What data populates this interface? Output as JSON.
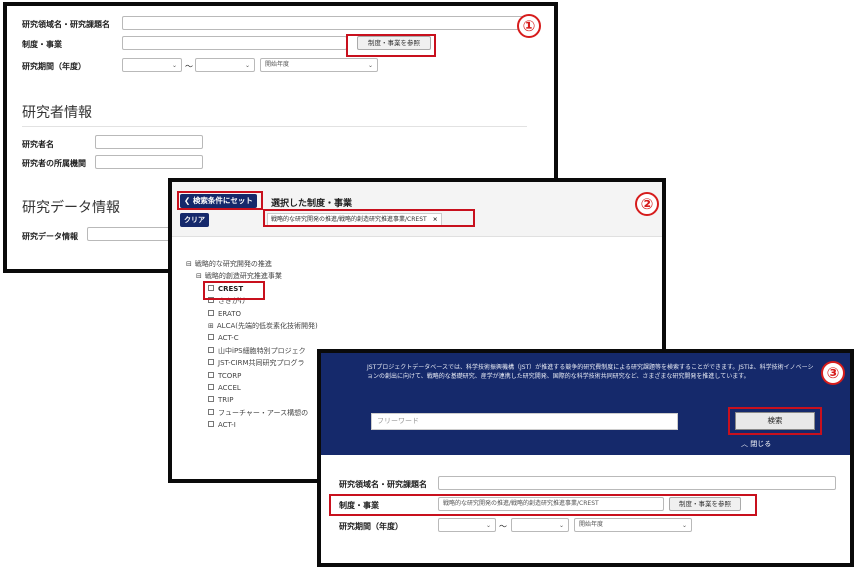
{
  "panel1": {
    "label_title": "研究領域名・研究課題名",
    "label_program": "制度・事業",
    "label_period": "研究期間（年度）",
    "period_tilde": "〜",
    "select_start": "",
    "select_end": "",
    "select_type": "開始年度",
    "ref_button": "制度・事業を参照",
    "section_researcher": "研究者情報",
    "label_researcher": "研究者名",
    "label_affiliation": "研究者の所属機関",
    "section_data": "研究データ情報",
    "label_data": "研究データ情報",
    "badge": "①"
  },
  "panel2": {
    "back_button": "検索条件にセット",
    "clear_button": "クリア",
    "heading": "選択した制度・事業",
    "selected_tag": "戦略的な研究開発の推進/戦略的創造研究推進事業/CREST",
    "tag_close": "×",
    "badge": "②",
    "tree": [
      {
        "toggle": "⊟",
        "label": "戦略的な研究開発の推進",
        "checkbox": false,
        "bold": false,
        "indent": 0
      },
      {
        "toggle": "⊟",
        "label": "戦略的創造研究推進事業",
        "checkbox": false,
        "bold": false,
        "indent": 1
      },
      {
        "toggle": "",
        "label": "CREST",
        "checkbox": true,
        "bold": true,
        "indent": 2
      },
      {
        "toggle": "",
        "label": "さきがけ",
        "checkbox": true,
        "bold": false,
        "indent": 2
      },
      {
        "toggle": "",
        "label": "ERATO",
        "checkbox": true,
        "bold": false,
        "indent": 2
      },
      {
        "toggle": "⊞",
        "label": "ALCA(先端的低炭素化技術開発)",
        "checkbox": false,
        "bold": false,
        "indent": 2
      },
      {
        "toggle": "",
        "label": "ACT-C",
        "checkbox": true,
        "bold": false,
        "indent": 2
      },
      {
        "toggle": "",
        "label": "山中iPS細胞特別プロジェク",
        "checkbox": true,
        "bold": false,
        "indent": 2
      },
      {
        "toggle": "",
        "label": "JST-CIRM共同研究プログラ",
        "checkbox": true,
        "bold": false,
        "indent": 2
      },
      {
        "toggle": "",
        "label": "TCORP",
        "checkbox": true,
        "bold": false,
        "indent": 2
      },
      {
        "toggle": "",
        "label": "ACCEL",
        "checkbox": true,
        "bold": false,
        "indent": 2
      },
      {
        "toggle": "",
        "label": "TRIP",
        "checkbox": true,
        "bold": false,
        "indent": 2
      },
      {
        "toggle": "",
        "label": "フューチャー・アース構想の",
        "checkbox": true,
        "bold": false,
        "indent": 2
      },
      {
        "toggle": "",
        "label": "ACT-I",
        "checkbox": true,
        "bold": false,
        "indent": 2
      }
    ]
  },
  "panel3": {
    "description": "JSTプロジェクトデータベースでは、科学技術振興機構（JST）が推進する競争的研究費制度による研究課題等を検索することができます。JSTは、科学技術イノベーションの創出に向けて、戦略的な基礎研究、産学が連携した研究開発、国際的な科学技術共同研究など、さまざまな研究開発を推進しています。",
    "free_word_placeholder": "フリーワード",
    "search_button": "検索",
    "close_label": "閉じる",
    "label_title": "研究領域名・研究課題名",
    "label_program": "制度・事業",
    "program_value": "戦略的な研究開発の推進/戦略的創造研究推進事業/CREST",
    "ref_button": "制度・事業を参照",
    "label_period": "研究期間（年度）",
    "period_tilde": "〜",
    "select_type": "開始年度",
    "badge": "③"
  },
  "colors": {
    "navy": "#15296b",
    "annotation_red": "#c8101d"
  }
}
